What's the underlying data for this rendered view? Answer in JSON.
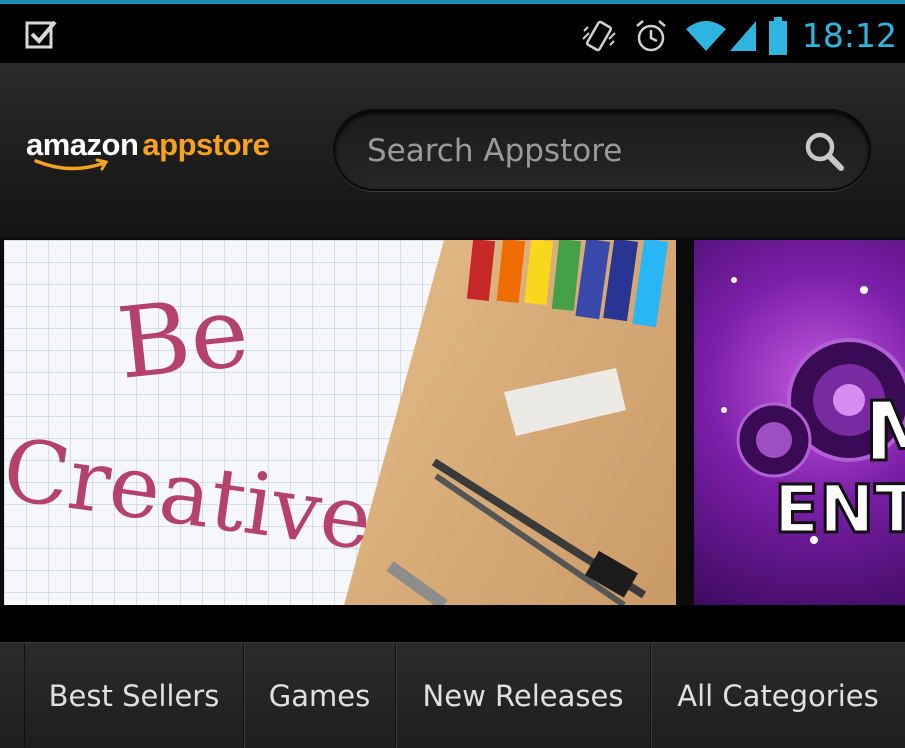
{
  "status_bar": {
    "time": "18:12",
    "icons": [
      "checkbox-notification-icon",
      "vibrate-icon",
      "alarm-icon",
      "wifi-icon",
      "signal-icon",
      "battery-icon"
    ],
    "accent_color": "#2fb3df"
  },
  "header": {
    "logo_part1": "amazon",
    "logo_part2": "appstore",
    "search": {
      "placeholder": "Search Appstore"
    }
  },
  "banners": [
    {
      "text_line1": "Be",
      "text_line2": "Creative"
    },
    {
      "text_line1": "M",
      "text_line2": "ENT"
    }
  ],
  "nav": {
    "items": [
      {
        "label": "Best Sellers"
      },
      {
        "label": "Games"
      },
      {
        "label": "New Releases"
      },
      {
        "label": "All Categories"
      }
    ]
  },
  "colors": {
    "brand_orange": "#f7a121",
    "banner_text": "#b5426a"
  }
}
